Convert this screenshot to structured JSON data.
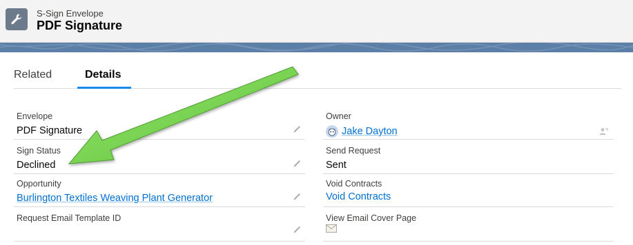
{
  "header": {
    "object_type": "S-Sign Envelope",
    "title": "PDF Signature",
    "icon": "wrench-icon"
  },
  "tabs": [
    {
      "label": "Related",
      "active": false
    },
    {
      "label": "Details",
      "active": true
    }
  ],
  "fields": {
    "envelope": {
      "label": "Envelope",
      "value": "PDF Signature"
    },
    "sign_status": {
      "label": "Sign Status",
      "value": "Declined"
    },
    "opportunity": {
      "label": "Opportunity",
      "value": "Burlington Textiles Weaving Plant Generator"
    },
    "request_email_template_id": {
      "label": "Request Email Template ID",
      "value": ""
    },
    "owner": {
      "label": "Owner",
      "value": "Jake Dayton"
    },
    "send_request": {
      "label": "Send Request",
      "value": "Sent"
    },
    "void_contracts": {
      "label": "Void Contracts",
      "value": "Void Contracts"
    },
    "view_email_cover_page": {
      "label": "View Email Cover Page",
      "icon": "envelope-icon"
    }
  },
  "colors": {
    "link": "#0070d2",
    "tab_active": "#1589ee",
    "arrow": "#7ed957",
    "header_bg": "#f3f3f3",
    "band": "#5b7fa6"
  }
}
